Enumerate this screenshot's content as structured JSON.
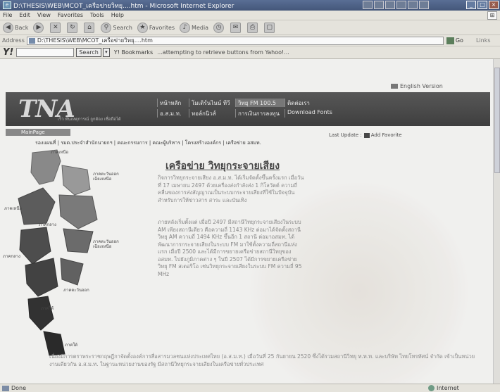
{
  "window": {
    "title": "D:\\THESIS\\WEB\\MCOT_เครือข่ายวิทยุ....htm - Microsoft Internet Explorer"
  },
  "menu": [
    "File",
    "Edit",
    "View",
    "Favorites",
    "Tools",
    "Help"
  ],
  "toolbar": {
    "back": "Back",
    "search": "Search",
    "favorites": "Favorites",
    "media": "Media"
  },
  "address": {
    "label": "Address",
    "value": "D:\\THESIS\\WEB\\MCOT_เครือข่ายวิทยุ....htm",
    "go": "Go",
    "links": "Links"
  },
  "yahoo": {
    "logo": "Y!",
    "search_button": "Search",
    "bookmarks": "Y! Bookmarks",
    "message": "...attempting to retrieve buttons from Yahoo!..."
  },
  "site": {
    "english_version": "English Version",
    "logo": "TNA",
    "slogan": "เร็ว ทันเหตุการณ์ ถูกต้อง เชื่อถือได้",
    "nav_row1": [
      "หน้าหลัก",
      "โมเดิร์นไนน์ ทีวี",
      "วิทยุ FM 100.5",
      "ติดต่อเรา"
    ],
    "nav_row2": [
      "อ.ส.ม.ท.",
      "ทอล์กนิวส์",
      "การเงินการลงทุน",
      "Download Fonts"
    ],
    "mainpage_tab": "MainPage",
    "last_update": "Last Update :",
    "add_favorite": "Add Favorite",
    "breadcrumb": "รองแผนที่ | รมต.ประจำสำนักนายกฯ | คณะกรรมการ | คณะผู้บริหาร | โครงสร้างองค์กร | เครือข่าย อสมท."
  },
  "map_labels": [
    "ภาคเหนือ",
    "ภาคตะวันออกเฉียงเหนือ",
    "ภาคเหนือ",
    "ภาคกลาง",
    "ภาคตะวันออกเฉียงเหนือ",
    "ภาคกลาง",
    "ภาคตะวันออก",
    "ภาคใต้",
    "ภาคใต้"
  ],
  "article": {
    "title": "เครือข่าย วิทยุกระจายเสียง",
    "para1": "กิจการวิทยุกระจายเสียง อ.ส.ม.ท. ได้เริ่มจัดตั้งขึ้นครั้งแรก เมื่อวันที่ 17 เมษายน 2497 ด้วยเครื่องส่งกำลังส่ง 1 กิโลวัตต์ ความถี่คลื่นของการส่งสัญญาณเป็นระบบกระจายเสียงที่ใช้ในปัจจุบัน สำหรับการให้ข่าวสาร สาระ และบันเทิง",
    "para2": "ภายหลังเริ่มตั้งแต่ เมื่อปี 2497 มีสถานีวิทยุกระจายเสียงในระบบ AM เพียงสถานีเดียว คือความถี่ 1143 KHz ต่อมาได้จัดตั้งสถานีวิทยุ AM ความถี่ 1494 KHz ขึ้นอีก 1 สถานี ต่อมาอสมท. ได้พัฒนาการกระจายเสียงในระบบ FM มาใช้ตั้งความถี่สถานีแห่งแรก เมื่อปี 2500 และได้มีการขยายเครือข่ายสถานีวิทยุของ อสมท. ไปยังภูมิภาคต่าง ๆ ในปี 2507 ได้มีการขยายเครือข่ายวิทยุ FM สเตอริโอ เช่นวิทยุกระจายเสียงในระบบ FM ความถี่ 95 MHz",
    "para3": "เนื่องมีการตราพระราชกฤษฎีกาจัดตั้งองค์การสื่อสารมวลชนแห่งประเทศไทย (อ.ส.ม.ท.) เมื่อวันที่ 25 กันยายน 2520 ซึ่งได้รวมสถานีวิทยุ ท.ท.ท. และบริษัท ไทยโทรทัศน์ จำกัด เข้าเป็นหน่วยงานเดียวกัน อ.ส.ม.ท. ในฐานะหน่วยงานของรัฐ มีสถานีวิทยุกระจายเสียงในเครือข่ายทั่วประเทศ"
  },
  "status": {
    "left": "Done",
    "zone": "Internet"
  }
}
